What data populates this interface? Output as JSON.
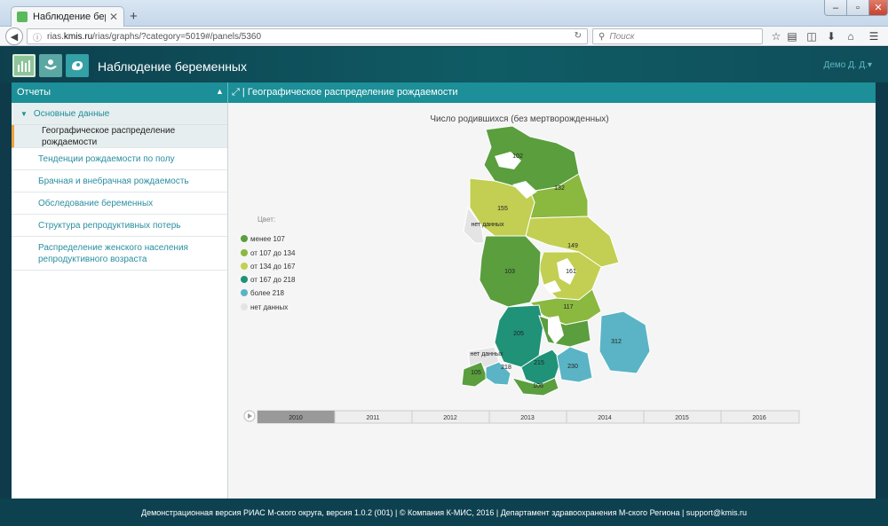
{
  "browser": {
    "tab_title": "Наблюдение беременных...",
    "url_prefix": "rias.",
    "url_host": "kmis.ru",
    "url_path": "/rias/graphs/?category=5019#/panels/5360",
    "search_placeholder": "Поиск"
  },
  "app": {
    "title": "Наблюдение беременных",
    "user": "Демо Д. Д.▾"
  },
  "panel": {
    "sidebar_header": "Отчеты",
    "content_header": "Географическое распределение рождаемости"
  },
  "sidebar": {
    "group": "Основные данные",
    "items": [
      {
        "label": "Географическое распределение рождаемости",
        "active": true
      },
      {
        "label": "Тенденции рождаемости по полу"
      },
      {
        "label": "Брачная и внебрачная рождаемость"
      },
      {
        "label": "Обследование беременных"
      },
      {
        "label": "Структура репродуктивных потерь"
      },
      {
        "label": "Распределение женского населения репродуктивного возраста"
      }
    ]
  },
  "chart_data": {
    "type": "choropleth",
    "title": "Число родившихся (без мертворожденных)",
    "legend_title": "Цвет:",
    "legend": [
      {
        "label": "менее 107",
        "color": "#5a9e3e"
      },
      {
        "label": "от 107 до 134",
        "color": "#8bb83f"
      },
      {
        "label": "от 134 до 167",
        "color": "#c2cf52"
      },
      {
        "label": "от 167 до 218",
        "color": "#1f9278"
      },
      {
        "label": "более 218",
        "color": "#5ab4c5"
      },
      {
        "label": "нет данных",
        "color": "#e4e4e4"
      }
    ],
    "region_values": [
      "102",
      "132",
      "155",
      "нет данных",
      "149",
      "161",
      "103",
      "117",
      "205",
      "312",
      "нет данных",
      "105",
      "218",
      "215",
      "230",
      "106"
    ],
    "timeline": [
      "2010",
      "2011",
      "2012",
      "2013",
      "2014",
      "2015",
      "2016"
    ],
    "selected_year": "2010"
  },
  "footer": {
    "text": "Демонстрационная версия РИАС М-ского округа, версия 1.0.2 (001) | © Компания К-МИС, 2016 | Департамент здравоохранения М-ского Региона | support@kmis.ru"
  }
}
